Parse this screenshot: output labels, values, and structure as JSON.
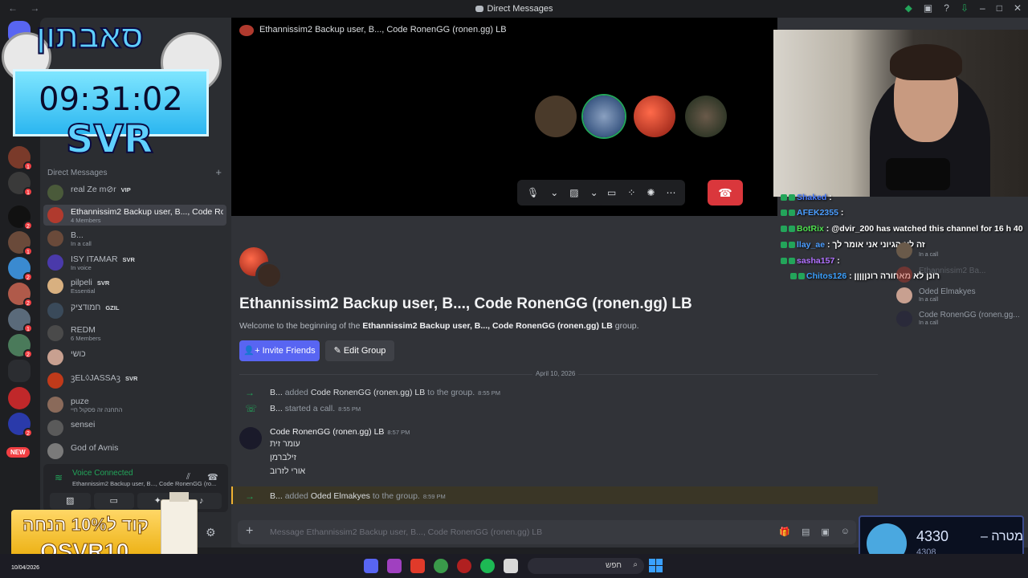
{
  "titlebar": {
    "title": "Direct Messages",
    "nav": "← →"
  },
  "overlay": {
    "timer": "09:31:02",
    "brand": "SVR",
    "logo_text": "סאבתון",
    "promo_line1": "קוד ל10% הנחה",
    "promo_code": "OSVR10"
  },
  "sidebar": {
    "section_label": "Direct Messages",
    "items": [
      {
        "name": "real Ze m⊘r",
        "tag": "VIP",
        "sub": ""
      },
      {
        "name": "Ethannissim2 Backup user, B..., Code Ro...",
        "sub": "4 Members"
      },
      {
        "name": "B...",
        "sub": "In a call"
      },
      {
        "name": "ISY ITAMAR",
        "tag": "SVR",
        "sub": "In voice"
      },
      {
        "name": "pilpeli",
        "tag": "SVR",
        "sub": "Essential"
      },
      {
        "name": "חמודציק",
        "tag": "GZIL",
        "sub": ""
      },
      {
        "name": "REDM",
        "sub": "6 Members"
      },
      {
        "name": "כושי",
        "sub": ""
      },
      {
        "name": "ꝫEL◊JASSAꝫ",
        "tag": "SVR",
        "sub": ""
      },
      {
        "name": "puze",
        "sub": "התחנה זה פסקול חיי"
      },
      {
        "name": "sensei",
        "sub": ""
      },
      {
        "name": "God of Avnis",
        "sub": ""
      }
    ]
  },
  "voice": {
    "status": "Voice Connected",
    "channel": "Ethannissim2 Backup user, B..., Code RonenGG (ro..."
  },
  "rail": {
    "new_label": "NEW",
    "badges": [
      "1",
      "1",
      "2",
      "1",
      "2",
      "2",
      "1",
      "2",
      "2"
    ]
  },
  "call": {
    "title": "Ethannissim2 Backup user, B..., Code RonenGG (ronen.gg) LB",
    "hangup_icon": "phone-hangup-icon"
  },
  "group": {
    "title": "Ethannissim2 Backup user, B..., Code RonenGG (ronen.gg) LB",
    "welcome_prefix": "Welcome to the beginning of the",
    "welcome_name": "Ethannissim2 Backup user, B..., Code RonenGG (ronen.gg) LB",
    "welcome_suffix": "group.",
    "invite_label": "Invite Friends",
    "edit_label": "Edit Group"
  },
  "messages": {
    "date": "April 10, 2026",
    "sys1": {
      "who": "B...",
      "action": "added",
      "target": "Code RonenGG (ronen.gg) LB",
      "suffix": "to the group.",
      "time": "8:55 PM"
    },
    "sys2": {
      "who": "B...",
      "action": "started a call.",
      "time": "8:55 PM"
    },
    "post": {
      "author": "Code RonenGG (ronen.gg) LB",
      "time": "8:57 PM",
      "lines": [
        "עומר זית",
        "זילברמן",
        "אורי לזרוב"
      ]
    },
    "sys3": {
      "who": "B...",
      "action": "added",
      "target": "Oded Elmakyes",
      "suffix": "to the group.",
      "time": "8:59 PM"
    }
  },
  "composer": {
    "placeholder": "Message Ethannissim2 Backup user, B..., Code RonenGG (ronen.gg) LB"
  },
  "members": [
    {
      "name": "",
      "sub": "In a call"
    },
    {
      "name": "Ethannissim2 Ba...",
      "sub": ""
    },
    {
      "name": "Oded Elmakyes",
      "sub": "In a call"
    },
    {
      "name": "Code RonenGG (ronen.gg...",
      "sub": "In a call"
    }
  ],
  "chat": [
    {
      "user": "Shaked",
      "msg": "",
      "color": "#4a7dff"
    },
    {
      "user": "AFEK2355",
      "msg": "",
      "color": "#4a9dff"
    },
    {
      "user": "BotRix",
      "msg": "@dvir_200 has watched this channel for 16 h 40",
      "color": "#4ee04e"
    },
    {
      "user": "llay_ae",
      "msg": "זה לא הגיוני אני אומר לך",
      "color": "#4a9dff"
    },
    {
      "user": "sasha157",
      "msg": "",
      "color": "#b070ff"
    },
    {
      "user": "Chitos126",
      "msg": "רונן לא מאחורה רונןןןןן",
      "color": "#3aa0ff"
    }
  ],
  "goal": {
    "current": "4330",
    "label": "מטרה",
    "sub": "4308"
  },
  "taskbar": {
    "date": "10/04/2026",
    "search": "חפש"
  }
}
